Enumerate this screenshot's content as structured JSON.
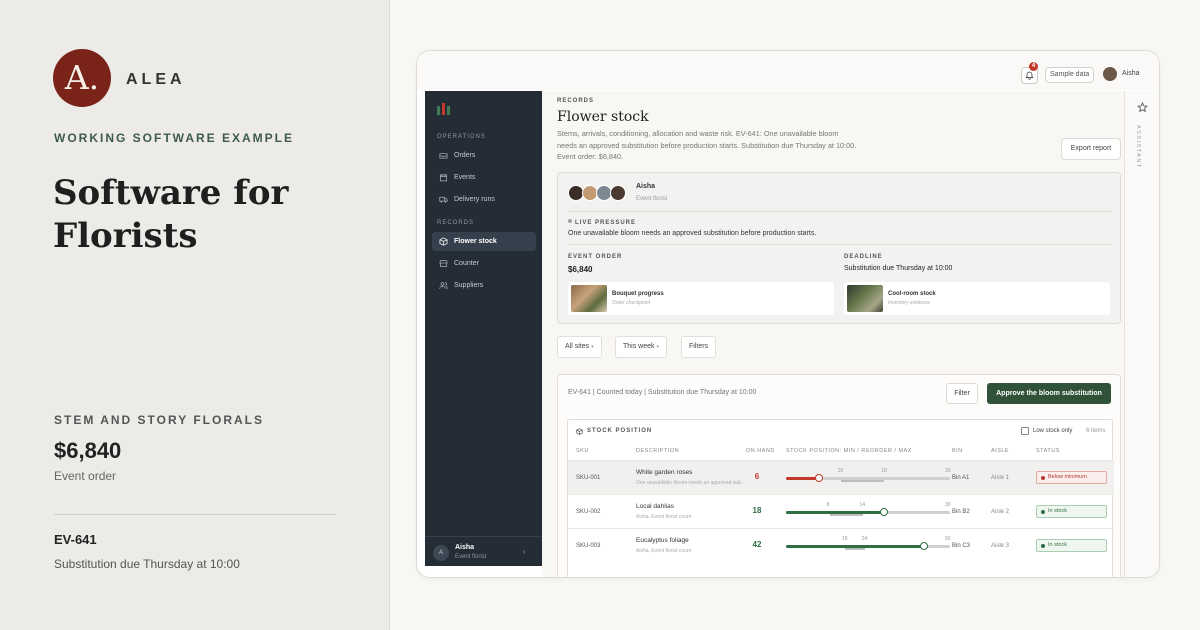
{
  "brand": {
    "monogram": "A.",
    "name": "ALEA"
  },
  "hero_text": {
    "eyebrow": "WORKING SOFTWARE EXAMPLE",
    "headline": "Software for Florists",
    "client": "STEM AND STORY FLORALS",
    "amount": "$6,840",
    "amount_label": "Event order",
    "order_id": "EV-641",
    "order_note": "Substitution due Thursday at 10:00"
  },
  "topbar": {
    "notification_count": "4",
    "sample_label": "Sample data",
    "user_name": "Aisha"
  },
  "sidebar": {
    "sections": [
      {
        "label": "OPERATIONS",
        "items": [
          {
            "label": "Orders",
            "icon": "inbox-icon"
          },
          {
            "label": "Events",
            "icon": "calendar-icon"
          },
          {
            "label": "Delivery runs",
            "icon": "truck-icon"
          }
        ]
      },
      {
        "label": "RECORDS",
        "items": [
          {
            "label": "Flower stock",
            "icon": "box-icon",
            "active": true
          },
          {
            "label": "Counter",
            "icon": "store-icon"
          },
          {
            "label": "Suppliers",
            "icon": "users-icon"
          }
        ]
      }
    ],
    "footer": {
      "initial": "A",
      "name": "Aisha",
      "role": "Event florist"
    }
  },
  "page": {
    "section_label": "RECORDS",
    "title": "Flower stock",
    "description": "Stems, arrivals, conditioning, allocation and waste risk. EV-641: One unavailable bloom needs an approved substitution before production starts. Substitution due Thursday at 10:00. Event order: $6,840.",
    "export_label": "Export report"
  },
  "summary": {
    "person": "Aisha",
    "role": "Event florist",
    "pressure_label": "LIVE PRESSURE",
    "pressure_text": "One unavailable bloom needs an approved substitution before production starts.",
    "event_order_label": "EVENT ORDER",
    "event_order_value": "$6,840",
    "deadline_label": "DEADLINE",
    "deadline_value": "Substitution due Thursday at 10:00",
    "tiles": [
      {
        "title": "Bouquet progress",
        "subtitle": "Order checkpoint"
      },
      {
        "title": "Cool-room stock",
        "subtitle": "Inventory evidence"
      }
    ]
  },
  "filters": {
    "site": "All sites",
    "period": "This week",
    "more": "Filters"
  },
  "board": {
    "meta": "EV-641 | Counted today | Substitution due Thursday at 10:00",
    "filter_label": "Filter",
    "approve_label": "Approve the bloom substitution"
  },
  "stock": {
    "heading": "STOCK POSITION",
    "low_stock_label": "Low stock only",
    "item_count": "6 items",
    "columns": [
      "SKU",
      "DESCRIPTION",
      "ON HAND",
      "STOCK POSITION: MIN / REORDER / MAX",
      "BIN",
      "AISLE",
      "STATUS"
    ],
    "rows": [
      {
        "sku": "SKU-001",
        "description": "White garden roses",
        "note": "One unavailable bloom needs an approved substitution",
        "on_hand": "6",
        "min": "10",
        "reorder": "18",
        "max": "30",
        "position": 6,
        "bin": "Bin A1",
        "aisle": "Aisle 1",
        "status": "Below minimum",
        "tone": "red"
      },
      {
        "sku": "SKU-002",
        "description": "Local dahlias",
        "note": "Aisha, Event florist count",
        "on_hand": "18",
        "min": "8",
        "reorder": "14",
        "max": "30",
        "position": 18,
        "bin": "Bin B2",
        "aisle": "Aisle 2",
        "status": "In stock",
        "tone": "green"
      },
      {
        "sku": "SKU-003",
        "description": "Eucalyptus foliage",
        "note": "Aisha, Event florist count",
        "on_hand": "42",
        "min": "18",
        "reorder": "24",
        "max": "50",
        "position": 42,
        "bin": "Bin C3",
        "aisle": "Aisle 3",
        "status": "In stock",
        "tone": "green"
      }
    ]
  },
  "assistant": {
    "label": "ASSISTANT"
  },
  "colors": {
    "accent": "#2f5239",
    "brand": "#7a2419",
    "sidebar": "#242c35",
    "danger": "#c0392b",
    "ok": "#2f6e42"
  }
}
